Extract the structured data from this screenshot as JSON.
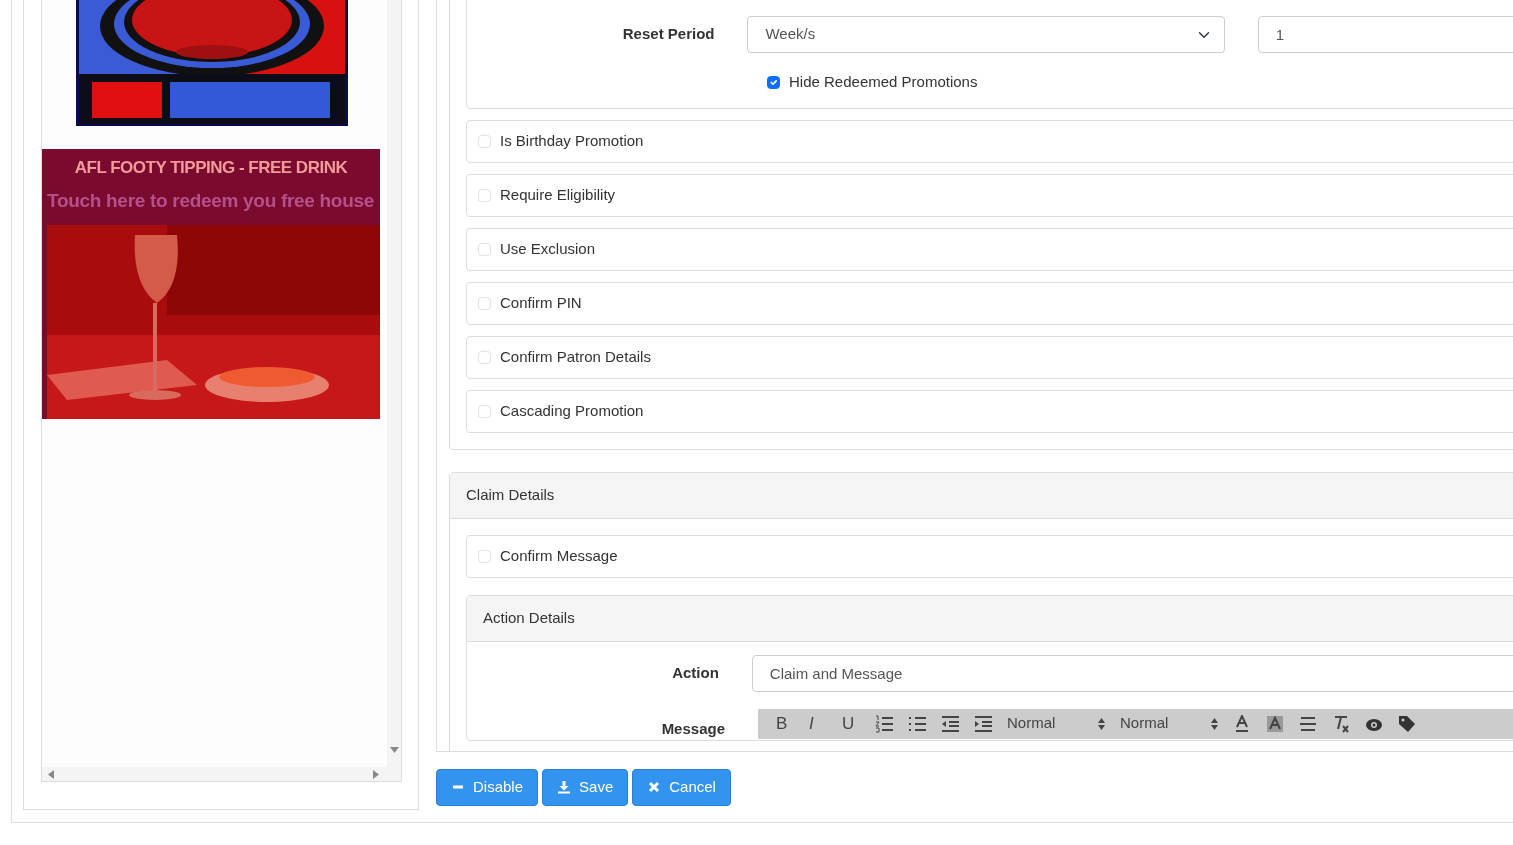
{
  "promo_preview": {
    "title": "AFL FOOTY TIPPING - FREE DRINK",
    "subtitle": "Touch here to redeem you free house"
  },
  "reset_period": {
    "label": "Reset Period",
    "value": "Week/s",
    "count": "1"
  },
  "hide_redeemed": {
    "label": "Hide Redeemed Promotions",
    "checked": true
  },
  "options": [
    {
      "label": "Is Birthday Promotion",
      "checked": false
    },
    {
      "label": "Require Eligibility",
      "checked": false
    },
    {
      "label": "Use Exclusion",
      "checked": false
    },
    {
      "label": "Confirm PIN",
      "checked": false
    },
    {
      "label": "Confirm Patron Details",
      "checked": false
    },
    {
      "label": "Cascading Promotion",
      "checked": false
    }
  ],
  "claim_details": {
    "title": "Claim Details",
    "confirm_message": {
      "label": "Confirm Message",
      "checked": false
    },
    "action_details": {
      "title": "Action Details",
      "action": {
        "label": "Action",
        "value": "Claim and Message"
      },
      "message": {
        "label": "Message",
        "toolbar": [
          {
            "kind": "bold",
            "label": "B"
          },
          {
            "kind": "italic",
            "label": "I"
          },
          {
            "kind": "underline",
            "label": "U"
          },
          {
            "kind": "ordered-list"
          },
          {
            "kind": "bullet-list"
          },
          {
            "kind": "outdent"
          },
          {
            "kind": "indent"
          },
          {
            "kind": "picker",
            "label": "Normal"
          },
          {
            "kind": "picker",
            "label": "Normal"
          },
          {
            "kind": "text-color"
          },
          {
            "kind": "highlight"
          },
          {
            "kind": "strike"
          },
          {
            "kind": "clear-format"
          },
          {
            "kind": "preview"
          },
          {
            "kind": "tag"
          }
        ]
      }
    }
  },
  "buttons": [
    {
      "label": "Disable"
    },
    {
      "label": "Save"
    },
    {
      "label": "Cancel"
    }
  ]
}
